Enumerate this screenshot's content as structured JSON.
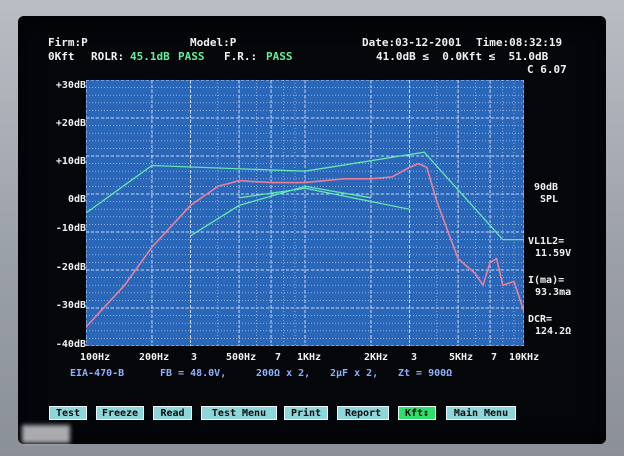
{
  "header": {
    "firm": "Firm:P",
    "model": "Model:P",
    "date": "Date:03-12-2001",
    "time": "Time:08:32:19",
    "kft": "0Kft",
    "rolr_label": "ROLR:",
    "rolr_value": "45.1dB",
    "rolr_status": "PASS",
    "fr_label": "F.R.:",
    "fr_status": "PASS",
    "range": "41.0dB ≤  0.0Kft ≤  51.0dB",
    "c_value": "C 6.07"
  },
  "y_axis": [
    "+30dB",
    "+20dB",
    "+10dB",
    "0dB",
    "-10dB",
    "-20dB",
    "-30dB",
    "-40dB"
  ],
  "x_axis": [
    "100Hz",
    "200Hz",
    "3",
    "500Hz",
    "7",
    "1KHz",
    "2KHz",
    "3",
    "5KHz",
    "7",
    "10KHz"
  ],
  "right_labels": {
    "spl_value": "90dB",
    "spl_label": "SPL",
    "vl1l2_label": "VL1L2=",
    "vl1l2_value": "11.59V",
    "ima_label": "I(ma)=",
    "ima_value": "93.3ma",
    "dcr_label": "DCR=",
    "dcr_value": "124.2Ω"
  },
  "footer": {
    "standard": "EIA-470-B",
    "fb": "FB = 48.0V,",
    "ohm": "200Ω x 2,",
    "cap": "2μF x 2,",
    "zt": "Zt = 900Ω"
  },
  "buttons": [
    "Test",
    "Freeze",
    "Read",
    "Test Menu",
    "Print",
    "Report",
    "Kft↕",
    "Main Menu"
  ],
  "colors": {
    "plot_bg": "#2a67b8",
    "grid": "#c9d6ee",
    "limit_line": "#63e6b0",
    "response_line": "#e8809c",
    "screen_bg": "#05060a",
    "button_bg": "#8dd6da",
    "button_active": "#2ee06b"
  },
  "chart_data": {
    "type": "line",
    "x_scale": "log",
    "xlim_hz": [
      100,
      10000
    ],
    "ylim": [
      -40,
      30
    ],
    "ylabel_unit": "dB",
    "series": [
      {
        "x": [
          100,
          150,
          200,
          300,
          400,
          500,
          700,
          1000,
          1500,
          2000,
          2500,
          3000,
          3300,
          3600,
          4000,
          4500,
          5000,
          6000,
          6500,
          7000,
          7500,
          8000,
          9000,
          10000
        ],
        "values": [
          -35,
          -24,
          -14,
          -3,
          2,
          3.5,
          3,
          3,
          4,
          4,
          4.5,
          7,
          8,
          7,
          -2,
          -10,
          -17,
          -21,
          -24,
          -18,
          -17,
          -24,
          -23,
          -31
        ]
      },
      {
        "x": [
          100,
          200,
          1000,
          3500,
          8000,
          10000
        ],
        "values": [
          -5,
          7.5,
          6,
          11,
          -12,
          -12
        ]
      },
      {
        "x": [
          300,
          500,
          1000,
          2000
        ],
        "values": [
          -11,
          -3,
          2,
          -1
        ]
      },
      {
        "x": [
          500,
          1000,
          3000
        ],
        "values": [
          -1,
          1.5,
          -4
        ]
      }
    ]
  }
}
